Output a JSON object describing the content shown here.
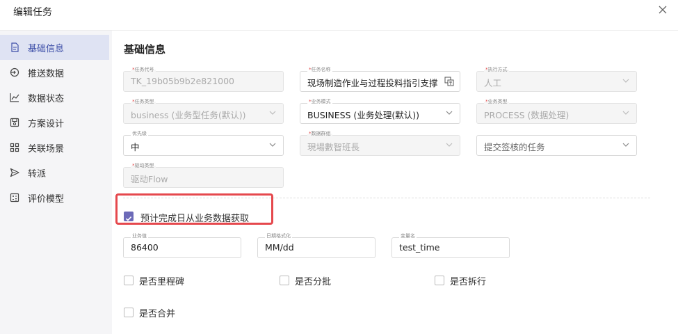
{
  "dialog": {
    "title": "编辑任务"
  },
  "sidebar": {
    "items": [
      {
        "label": "基础信息",
        "icon": "document-icon",
        "active": true
      },
      {
        "label": "推送数据",
        "icon": "push-icon"
      },
      {
        "label": "数据状态",
        "icon": "chart-icon"
      },
      {
        "label": "方案设计",
        "icon": "save-icon"
      },
      {
        "label": "关联场景",
        "icon": "grid-icon"
      },
      {
        "label": "转派",
        "icon": "send-icon"
      },
      {
        "label": "评价模型",
        "icon": "calculator-icon"
      }
    ]
  },
  "main": {
    "section_title": "基础信息",
    "fields": {
      "task_code": {
        "label": "任务代号",
        "required": true,
        "value": "TK_19b05b9b2e821000"
      },
      "task_name": {
        "label": "任务名称",
        "required": true,
        "value": "现场制造作业与过程投料指引支撑"
      },
      "exec_mode": {
        "label": "执行方式",
        "required": true,
        "value": "人工"
      },
      "task_type": {
        "label": "任务类型",
        "required": true,
        "value": "business (业务型任务(默认))"
      },
      "biz_mode": {
        "label": "业务模式",
        "required": true,
        "value": "BUSINESS (业务处理(默认))"
      },
      "biz_type": {
        "label": "业务类型",
        "required": true,
        "value": "PROCESS (数据处理)"
      },
      "priority": {
        "label": "优先级",
        "required": false,
        "value": "中"
      },
      "data_group": {
        "label": "数据群组",
        "required": true,
        "value": "現場數智班長"
      },
      "approval": {
        "label": "",
        "required": false,
        "value": "提交签核的任务"
      },
      "driver_type": {
        "label": "驱动类型",
        "required": true,
        "value": "驱动Flow"
      }
    },
    "predict_checkbox": {
      "label": "预计完成日从业务数据获取",
      "checked": true
    },
    "biz_value": {
      "label": "业务值",
      "value": "86400"
    },
    "date_format": {
      "label": "日期格式化",
      "value": "MM/dd"
    },
    "var_name": {
      "label": "变量名",
      "value": "test_time"
    },
    "checkboxes": {
      "milestone": "是否里程碑",
      "batch": "是否分批",
      "split_line": "是否拆行",
      "merge": "是否合并"
    }
  },
  "colors": {
    "accent": "#6c6ab8",
    "highlight": "#e5484d",
    "active_bg": "#dfe3f3"
  }
}
